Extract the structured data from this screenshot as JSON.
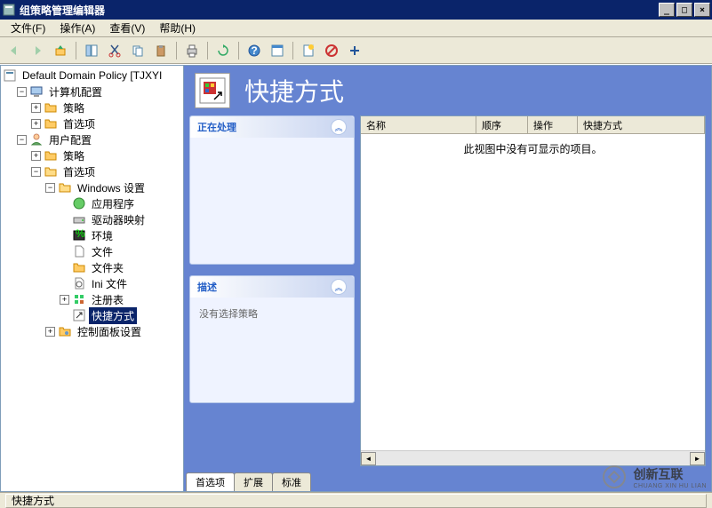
{
  "window": {
    "title": "组策略管理编辑器"
  },
  "menu": {
    "file": "文件(F)",
    "action": "操作(A)",
    "view": "查看(V)",
    "help": "帮助(H)"
  },
  "tree": {
    "root": "Default Domain Policy [TJXYI",
    "computer_config": "计算机配置",
    "policies1": "策略",
    "prefs1": "首选项",
    "user_config": "用户配置",
    "policies2": "策略",
    "prefs2": "首选项",
    "windows_settings": "Windows 设置",
    "apps": "应用程序",
    "drive_maps": "驱动器映射",
    "env": "环境",
    "files": "文件",
    "folders": "文件夹",
    "ini": "Ini 文件",
    "registry": "注册表",
    "shortcuts": "快捷方式",
    "control_panel": "控制面板设置"
  },
  "content": {
    "heading": "快捷方式",
    "panel_processing": "正在处理",
    "panel_desc": "描述",
    "desc_text": "没有选择策略",
    "empty_text": "此视图中没有可显示的项目。"
  },
  "columns": {
    "name": "名称",
    "order": "顺序",
    "action": "操作",
    "shortcut": "快捷方式"
  },
  "tabs": {
    "prefs": "首选项",
    "extended": "扩展",
    "standard": "标准"
  },
  "status": {
    "text": "快捷方式"
  },
  "watermark": {
    "brand": "创新互联",
    "sub": "CHUANG XIN HU LIAN"
  }
}
